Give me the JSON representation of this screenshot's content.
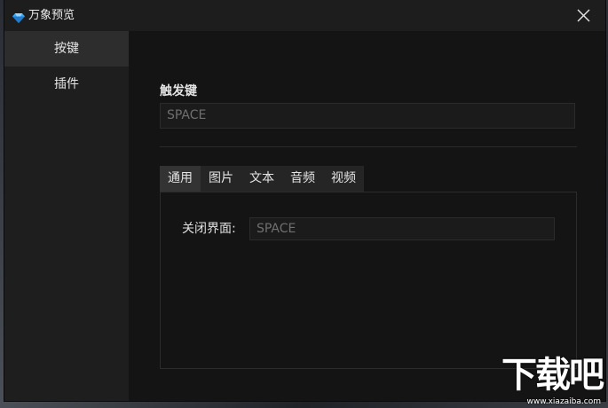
{
  "window": {
    "title": "万象预览",
    "icon": "app-gem-icon",
    "close_icon": "close-icon"
  },
  "sidebar": {
    "items": [
      {
        "label": "按键",
        "active": true
      },
      {
        "label": "插件",
        "active": false
      }
    ]
  },
  "main": {
    "trigger_section": {
      "label": "触发键",
      "value": "SPACE"
    },
    "tabs": [
      {
        "label": "通用",
        "active": true
      },
      {
        "label": "图片",
        "active": false
      },
      {
        "label": "文本",
        "active": false
      },
      {
        "label": "音频",
        "active": false
      },
      {
        "label": "视频",
        "active": false
      }
    ],
    "general": {
      "close_ui_label": "关闭界面:",
      "close_ui_value": "SPACE"
    }
  },
  "watermark": {
    "logo_text": "下载吧",
    "url": "www.xiazaiba.com"
  },
  "colors": {
    "window_bg": "#121212",
    "sidebar_bg": "#1e1e1e",
    "sidebar_active": "#2d2d2d",
    "tab_bg": "#252525",
    "tab_active": "#333333",
    "input_text": "#6f6f6f"
  }
}
